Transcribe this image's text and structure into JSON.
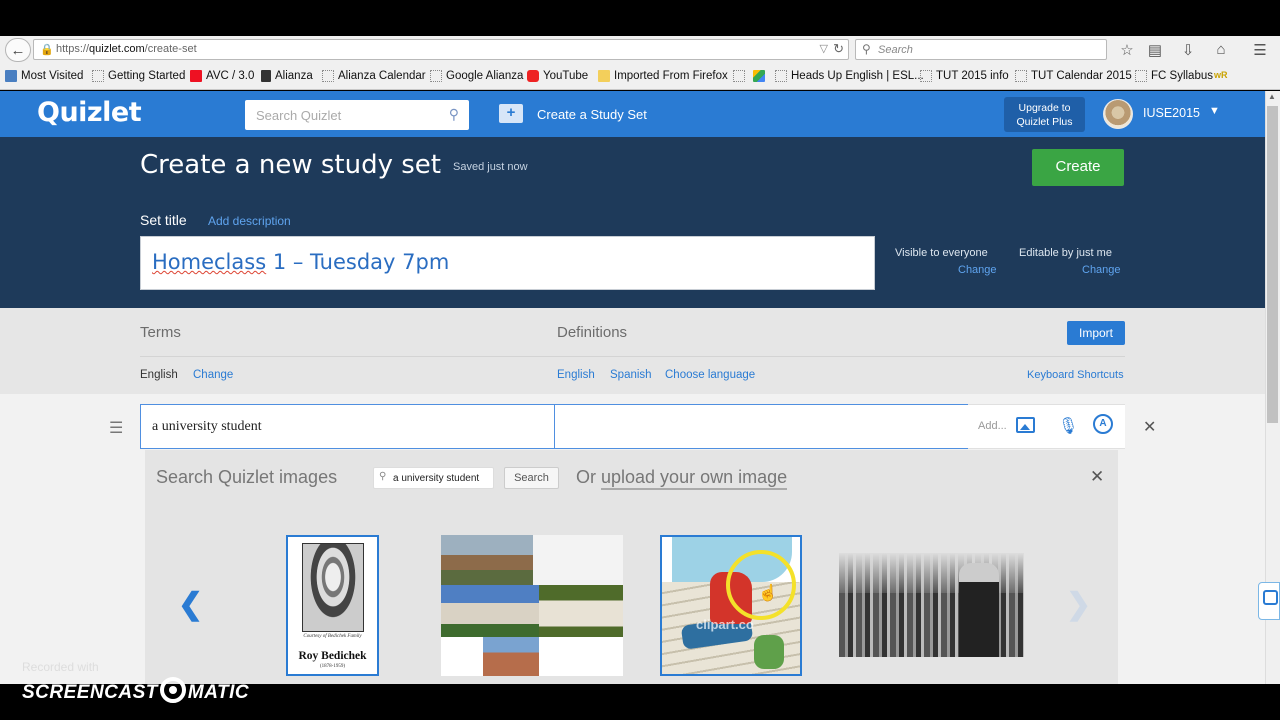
{
  "browser": {
    "url_prefix": "https://",
    "url_host": "quizlet.com",
    "url_path": "/create-set",
    "search_placeholder": "Search",
    "bookmarks": [
      {
        "label": "Most Visited",
        "icon": "blue"
      },
      {
        "label": "Getting Started",
        "icon": "dotted"
      },
      {
        "label": "AVC / 3.0",
        "icon": "red"
      },
      {
        "label": "Alianza",
        "icon": "dark"
      },
      {
        "label": "Alianza Calendar",
        "icon": "dotted"
      },
      {
        "label": "Google Alianza",
        "icon": "dotted"
      },
      {
        "label": "YouTube",
        "icon": "yt"
      },
      {
        "label": "Imported From Firefox",
        "icon": "folder"
      },
      {
        "label": "",
        "icon": "dotted"
      },
      {
        "label": "",
        "icon": "drive"
      },
      {
        "label": "Heads Up English | ESL...",
        "icon": "dotted"
      },
      {
        "label": "TUT 2015 info",
        "icon": "dotted"
      },
      {
        "label": "TUT Calendar 2015",
        "icon": "dotted"
      },
      {
        "label": "FC Syllabus",
        "icon": "dotted"
      }
    ],
    "bookmarks_overflow": "wR"
  },
  "header": {
    "logo": "Quizlet",
    "search_placeholder": "Search Quizlet",
    "create_link": "Create a Study Set",
    "upgrade_line1": "Upgrade to",
    "upgrade_line2": "Quizlet Plus",
    "username": "IUSE2015"
  },
  "title_section": {
    "page_title": "Create a new study set",
    "separator": "·",
    "saved_status": "Saved just now",
    "create_button": "Create",
    "set_title_label": "Set title",
    "add_description": "Add description",
    "title_value_part1": "Homeclass",
    "title_value_part2": " 1 – Tuesday 7pm",
    "visibility_label": "Visible to everyone",
    "visibility_change": "Change",
    "editable_label": "Editable by just me",
    "editable_change": "Change"
  },
  "terms_header": {
    "terms_label": "Terms",
    "definitions_label": "Definitions",
    "import_button": "Import",
    "term_language": "English",
    "term_language_change": "Change",
    "def_language_1": "English",
    "def_language_2": "Spanish",
    "choose_language": "Choose language",
    "keyboard_shortcuts": "Keyboard Shortcuts"
  },
  "card": {
    "term_value": "a university student",
    "definition_value": "",
    "add_label": "Add..."
  },
  "image_search": {
    "title": "Search Quizlet images",
    "query": "a university student",
    "search_button": "Search",
    "upload_prefix": "Or ",
    "upload_link": "upload your own image",
    "thumb1_caption": "Courtesy of Bedichek Family",
    "thumb1_name": "Roy Bedichek",
    "thumb1_years": "(1878-1959)",
    "thumb3_watermark": "clipart.co"
  },
  "watermark": {
    "recorded_with": "Recorded with",
    "brand_left": "SCREENCAST",
    "brand_right": "MATIC"
  },
  "colors": {
    "quizlet_blue": "#2a7bd3",
    "title_navy": "#1e3a5a",
    "create_green": "#3aa544"
  }
}
